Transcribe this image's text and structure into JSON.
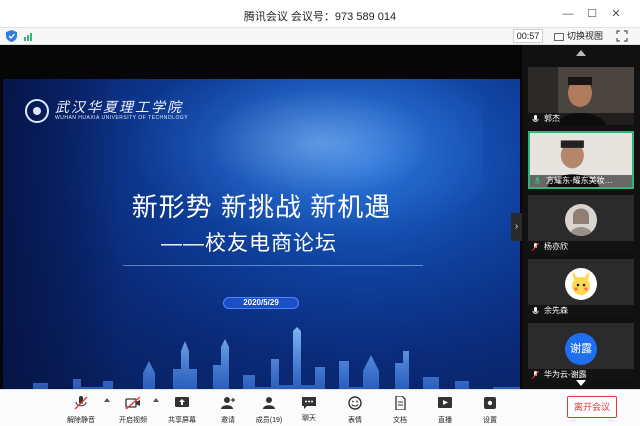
{
  "window": {
    "title": "腾讯会议 会议号：973 589 014"
  },
  "status": {
    "timer": "00:57",
    "switch_view": "切换视图"
  },
  "slide": {
    "school_cn": "武汉华夏理工学院",
    "school_en": "WUHAN HUAXIA UNIVERSITY OF TECHNOLOGY",
    "headline": "新形势 新挑战 新机遇",
    "subline": "——校友电商论坛",
    "date": "2020/5/29"
  },
  "participants": [
    {
      "name": "郭杰"
    },
    {
      "name": "方耀东-耀东美妆…"
    },
    {
      "name": "杨亦欣"
    },
    {
      "name": "余先森"
    },
    {
      "name": "华为云-谢露",
      "avatar_text": "谢露"
    }
  ],
  "toolbar": {
    "mute": "解除静音",
    "video": "开启视频",
    "share": "共享屏幕",
    "invite": "邀请",
    "members": "成员(19)",
    "chat": "聊天",
    "emoji": "表情",
    "docs": "文档",
    "live": "直播",
    "settings": "设置",
    "leave": "离开会议"
  },
  "colors": {
    "accent_green": "#2fb57a",
    "leave_red": "#e53935",
    "slide_blue": "#0e3e9a"
  }
}
